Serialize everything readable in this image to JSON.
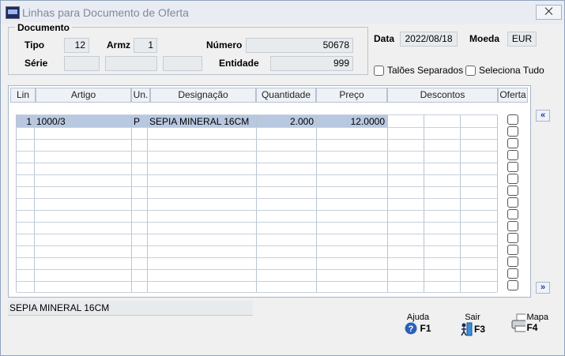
{
  "window": {
    "title": "Linhas para Documento de Oferta",
    "close_label": "⨉"
  },
  "documento": {
    "group_label": "Documento",
    "tipo_label": "Tipo",
    "tipo_value": "12",
    "armz_label": "Armz",
    "armz_value": "1",
    "numero_label": "Número",
    "numero_value": "50678",
    "serie_label": "Série",
    "serie_values": [
      "",
      "",
      ""
    ],
    "entidade_label": "Entidade",
    "entidade_value": "999"
  },
  "header": {
    "data_label": "Data",
    "data_value": "2022/08/18",
    "moeda_label": "Moeda",
    "moeda_value": "EUR",
    "taloes_label": "Talões Separados",
    "seleciona_label": "Seleciona Tudo"
  },
  "table": {
    "columns": [
      "Lin",
      "Artigo",
      "Un.",
      "Designação",
      "Quantidade",
      "Preço",
      "Descontos",
      "Oferta"
    ],
    "rows": [
      {
        "lin": "1",
        "artigo": "1000/3",
        "un": "P",
        "designacao": "SEPIA MINERAL 16CM",
        "quantidade": "2.000",
        "preco": "12.0000"
      }
    ]
  },
  "status_text": "SEPIA MINERAL 16CM",
  "footer": {
    "ajuda_label": "Ajuda",
    "ajuda_key": "F1",
    "sair_label": "Sair",
    "sair_key": "F3",
    "mapa_label": "Mapa",
    "mapa_key": "F4"
  },
  "icons": {
    "app": "app-icon",
    "scroll_up": "double-chevron-left-icon",
    "scroll_down": "double-chevron-right-icon",
    "help": "help-icon",
    "exit": "exit-door-icon",
    "print": "printer-icon"
  },
  "colors": {
    "accent": "#1a3a9c",
    "selection": "#b8c8e0",
    "field_bg": "#e8ebee"
  }
}
